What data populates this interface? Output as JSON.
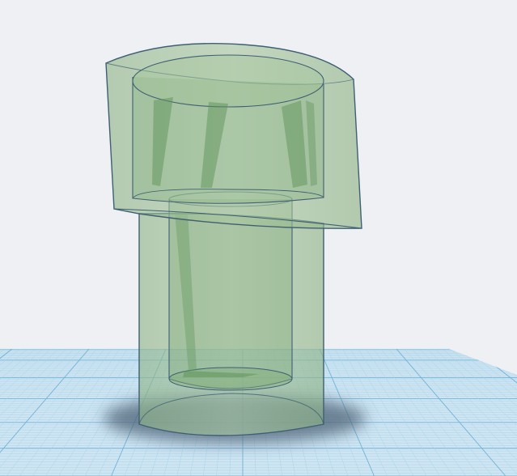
{
  "viewport": {
    "background": "#eef0f3",
    "grid_fill": "#cfe5f2",
    "grid_minor": "#a9d3ea",
    "grid_major": "#6fb3d8"
  },
  "model": {
    "fill": "#93bb86",
    "fill_opacity": 0.55,
    "edge": "#3f5f74",
    "shadow": "#5a6d80"
  }
}
